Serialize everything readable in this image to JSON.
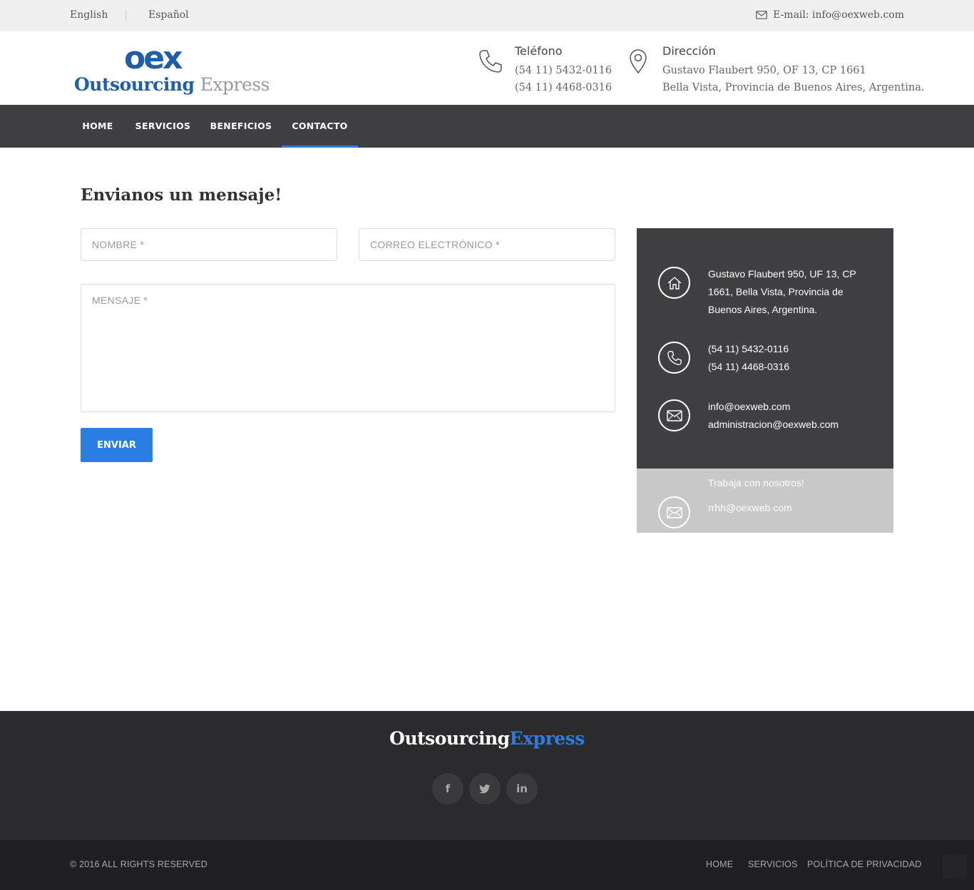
{
  "topbar": {
    "lang_en": "English",
    "lang_es": "Español",
    "email": "E-mail: info@oexweb.com"
  },
  "logo": {
    "mark": "oex",
    "word_a": "Outsourcing",
    "word_b": "Express",
    "brand_color": "#1f5ea8"
  },
  "header": {
    "phone_title": "Teléfono",
    "phone_1": "(54 11) 5432-0116",
    "phone_2": "(54 11) 4468-0316",
    "addr_title": "Dirección",
    "addr_1": "Gustavo Flaubert 950, OF 13, CP 1661",
    "addr_2": "Bella Vista, Provincia de Buenos Aires, Argentina."
  },
  "nav": {
    "items": [
      "HOME",
      "SERVICIOS",
      "BENEFICIOS",
      "CONTACTO"
    ],
    "active": "CONTACTO",
    "accent": "#2a7de1"
  },
  "form": {
    "title": "Envianos un mensaje!",
    "name_placeholder": "NOMBRE *",
    "email_placeholder": "CORREO ELECTRÓNICO *",
    "message_placeholder": "MENSAJE *",
    "submit": "ENVIAR"
  },
  "card": {
    "address": "Gustavo Flaubert 950, UF 13, CP 1661, Bella Vista, Provincia de Buenos Aires, Argentina.",
    "phone_1": "(54 11) 5432-0116",
    "phone_2": "(54 11) 4468-0316",
    "email_1": "info@oexweb.com",
    "email_2": "administracion@oexweb.com",
    "jobs_title": "Trabaja con nosotros!",
    "jobs_email": "rrhh@oexweb.com"
  },
  "footer": {
    "logo_a": "Outsourcing",
    "logo_b": "Express",
    "social": [
      "f",
      "in"
    ],
    "copyright": "© 2016 ALL RIGHTS RESERVED",
    "links": [
      "HOME",
      "SERVICIOS",
      "POLÍTICA DE PRIVACIDAD"
    ]
  }
}
